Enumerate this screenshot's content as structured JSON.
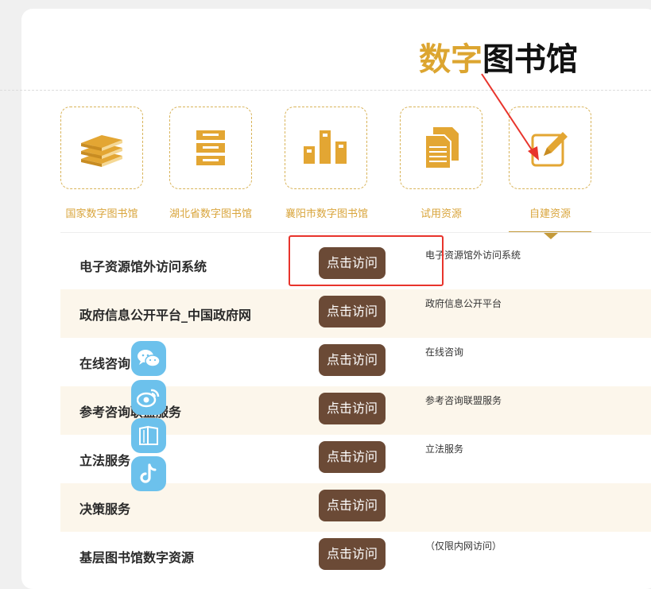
{
  "page_title": {
    "part1": "数字",
    "part2": "图书馆"
  },
  "categories": [
    {
      "label": "国家数字图书馆",
      "icon": "books-stack-icon"
    },
    {
      "label": "湖北省数字图书馆",
      "icon": "server-rack-icon"
    },
    {
      "label": "襄阳市数字图书馆",
      "icon": "bar-chart-icon"
    },
    {
      "label": "试用资源",
      "icon": "documents-icon"
    },
    {
      "label": "自建资源",
      "icon": "edit-pencil-icon",
      "selected": true
    }
  ],
  "resources": [
    {
      "title": "电子资源馆外访问系统",
      "button": "点击访问",
      "desc": "电子资源馆外访问系统"
    },
    {
      "title": "政府信息公开平台_中国政府网",
      "button": "点击访问",
      "desc": "政府信息公开平台"
    },
    {
      "title": "在线咨询",
      "button": "点击访问",
      "desc": "在线咨询"
    },
    {
      "title": "参考咨询联盟服务",
      "button": "点击访问",
      "desc": "参考咨询联盟服务"
    },
    {
      "title": "立法服务",
      "button": "点击访问",
      "desc": "立法服务"
    },
    {
      "title": "决策服务",
      "button": "点击访问",
      "desc": ""
    },
    {
      "title": "基层图书馆数字资源",
      "button": "点击访问",
      "desc": "（仅限内网访问）"
    }
  ],
  "floating_share": [
    "wechat-icon",
    "weibo-icon",
    "book-icon",
    "tiktok-icon"
  ],
  "colors": {
    "gold": "#dca530",
    "button_brown": "#6b4a36",
    "alt_row": "#fcf6eb",
    "highlight_red": "#e8342c",
    "share_blue": "#6cc1ec"
  }
}
